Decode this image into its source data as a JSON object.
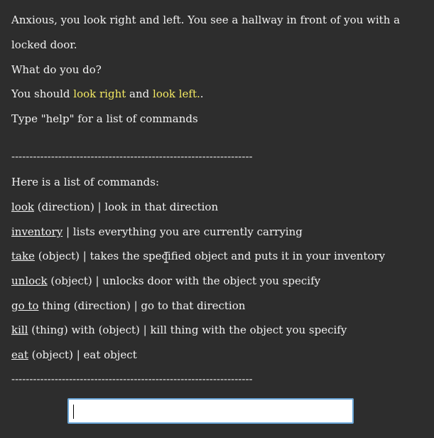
{
  "narrative": {
    "line1": "Anxious, you look right and left. You see a hallway in front of you with a",
    "line2": "locked door.",
    "prompt": "What do you do?",
    "hint_prefix": "You should ",
    "hint_right": "look right",
    "hint_and": " and ",
    "hint_left": "look left.",
    "hint_suffix": ".",
    "help_line": "Type \"help\" for a list of commands"
  },
  "divider": "-------------------------------------------------------------------",
  "commands_header": "Here is a list of commands:",
  "commands": [
    {
      "name": "look",
      "rest": " (direction) | look in that direction"
    },
    {
      "name": "inventory",
      "rest": " | lists everything you are currently carrying"
    },
    {
      "name": "take",
      "rest": " (object) | takes the specified object and puts it in your inventory"
    },
    {
      "name": "unlock",
      "rest": " (object) | unlocks door with the object you specify"
    },
    {
      "name": "go to",
      "rest": " thing (direction) | go to that direction"
    },
    {
      "name": "kill",
      "rest": " (thing) with (object) | kill thing with the object you specify"
    },
    {
      "name": "eat",
      "rest": " (object) | eat object"
    }
  ],
  "input": {
    "value": "",
    "placeholder": ""
  },
  "colors": {
    "background": "#2d2d2d",
    "text": "#f2f2f2",
    "highlight": "#f4ea63",
    "input_border": "#6aa6d8"
  }
}
